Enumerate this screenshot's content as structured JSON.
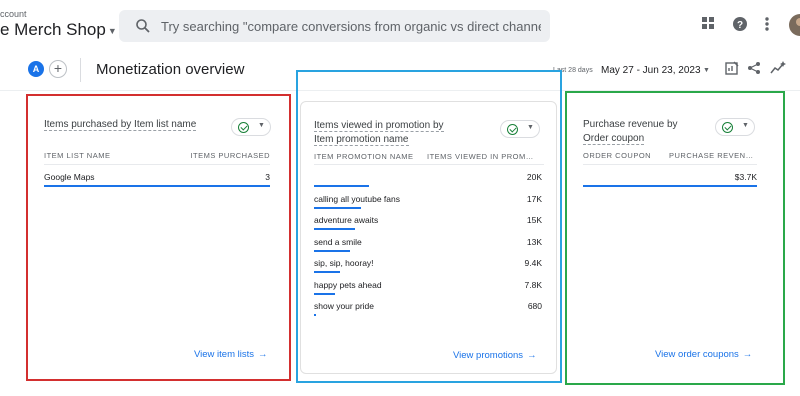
{
  "header": {
    "account_label": "ccount",
    "property_name": "e Merch Shop",
    "search_placeholder": "Try searching \"compare conversions from organic vs direct channels\""
  },
  "subheader": {
    "comparison_avatar": "A",
    "add_comparison": "+",
    "page_title": "Monetization overview",
    "date_label": "Last 28 days",
    "date_range": "May 27 - Jun 23, 2023"
  },
  "cards": [
    {
      "title_line1": "Items purchased by Item list name",
      "title_line2": "",
      "col1": "ITEM LIST NAME",
      "col2": "ITEMS PURCHASED",
      "rows": [
        {
          "label": "Google Maps",
          "value": "3",
          "fraction": 1.0
        }
      ],
      "link": "View item lists",
      "outline_color": "#d32f2f"
    },
    {
      "title_line1": "Items viewed in promotion by",
      "title_line2": "Item promotion name",
      "col1": "ITEM PROMOTION NAME",
      "col2": "ITEMS VIEWED IN PROM…",
      "rows": [
        {
          "label": "",
          "value": "20K",
          "fraction": 1.0
        },
        {
          "label": "calling all youtube fans",
          "value": "17K",
          "fraction": 0.85
        },
        {
          "label": "adventure awaits",
          "value": "15K",
          "fraction": 0.75
        },
        {
          "label": "send a smile",
          "value": "13K",
          "fraction": 0.65
        },
        {
          "label": "sip, sip, hooray!",
          "value": "9.4K",
          "fraction": 0.47
        },
        {
          "label": "happy pets ahead",
          "value": "7.8K",
          "fraction": 0.39
        },
        {
          "label": "show your pride",
          "value": "680",
          "fraction": 0.034
        }
      ],
      "link": "View promotions",
      "outline_color": "#29a3e0"
    },
    {
      "title_line1": "Purchase revenue by",
      "title_line2": "Order coupon",
      "col1": "ORDER COUPON",
      "col2": "PURCHASE REVEN…",
      "rows": [
        {
          "label": "",
          "value": "$3.7K",
          "fraction": 1.0
        }
      ],
      "link": "View order coupons",
      "outline_color": "#2aa84a"
    }
  ],
  "colors": {
    "accent": "#1a73e8",
    "check": "#188038"
  },
  "icons": [
    "search-icon",
    "apps-grid-icon",
    "help-icon",
    "more-vert-icon",
    "edit-report-icon",
    "share-icon",
    "insights-icon",
    "check-circle-icon",
    "chevron-down-icon",
    "arrow-right-icon"
  ]
}
